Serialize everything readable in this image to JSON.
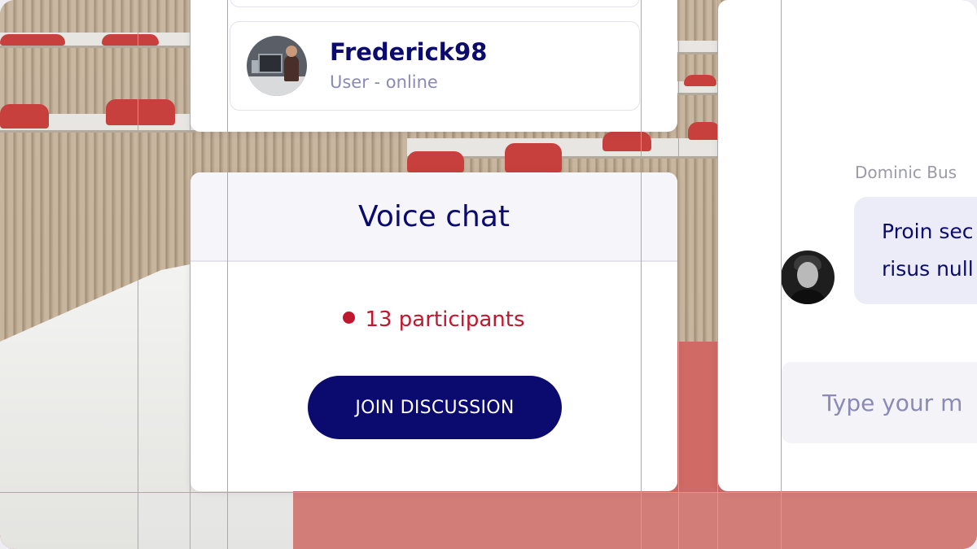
{
  "user_card": {
    "name": "Frederick98",
    "status": "User - online",
    "avatar_icon": "user-photo-avatar"
  },
  "voice_chat": {
    "title": "Voice chat",
    "participants": "13 participants",
    "status_color": "#c0172e",
    "join_label": "JOIN DISCUSSION"
  },
  "chat": {
    "sender": "Dominic Bus",
    "message_lines": [
      "Proin sec",
      "risus null"
    ],
    "input_placeholder": "Type your m"
  },
  "colors": {
    "brand": "#0b0a6e",
    "muted": "#8a89b8",
    "guide": "#49d4d0"
  }
}
